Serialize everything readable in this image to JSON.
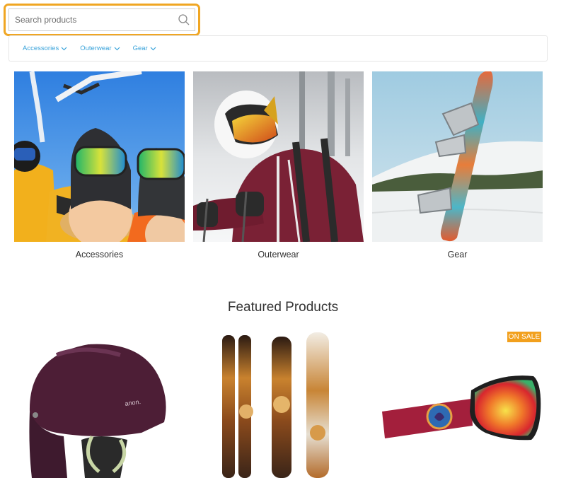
{
  "search": {
    "placeholder": "Search products"
  },
  "nav": {
    "items": [
      {
        "label": "Accessories"
      },
      {
        "label": "Outerwear"
      },
      {
        "label": "Gear"
      }
    ]
  },
  "categories": [
    {
      "label": "Accessories"
    },
    {
      "label": "Outerwear"
    },
    {
      "label": "Gear"
    }
  ],
  "featured": {
    "title": "Featured Products",
    "products": [
      {
        "image": "helmet-image",
        "brand_mark": "anon."
      },
      {
        "image": "skis-image"
      },
      {
        "image": "goggles-image",
        "badge": "ON SALE"
      }
    ]
  },
  "colors": {
    "highlight": "#f0a623",
    "link": "#3aa3da",
    "sale_badge": "#f2a01d"
  }
}
